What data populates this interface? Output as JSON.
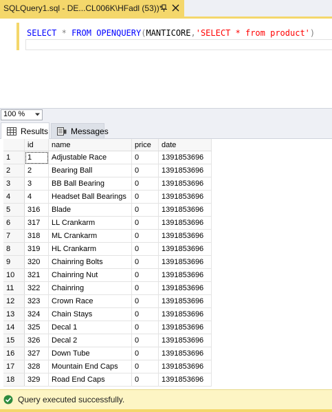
{
  "tab": {
    "title": "SQLQuery1.sql - DE...CL006K\\HFadl (53))*"
  },
  "editor": {
    "kw_select": "SELECT",
    "star": "*",
    "kw_from": "FROM",
    "kw_openquery": "OPENQUERY",
    "open_paren": "(",
    "server": "MANTICORE",
    "comma": ",",
    "query_string": "'SELECT * from product'",
    "close_paren": ")"
  },
  "zoom": {
    "value": "100 %"
  },
  "result_tabs": {
    "results": "Results",
    "messages": "Messages"
  },
  "grid": {
    "columns": [
      "id",
      "name",
      "price",
      "date"
    ],
    "rows": [
      {
        "n": "1",
        "id": "1",
        "name": "Adjustable Race",
        "price": "0",
        "date": "1391853696"
      },
      {
        "n": "2",
        "id": "2",
        "name": "Bearing Ball",
        "price": "0",
        "date": "1391853696"
      },
      {
        "n": "3",
        "id": "3",
        "name": "BB Ball Bearing",
        "price": "0",
        "date": "1391853696"
      },
      {
        "n": "4",
        "id": "4",
        "name": "Headset Ball Bearings",
        "price": "0",
        "date": "1391853696"
      },
      {
        "n": "5",
        "id": "316",
        "name": "Blade",
        "price": "0",
        "date": "1391853696"
      },
      {
        "n": "6",
        "id": "317",
        "name": "LL Crankarm",
        "price": "0",
        "date": "1391853696"
      },
      {
        "n": "7",
        "id": "318",
        "name": "ML Crankarm",
        "price": "0",
        "date": "1391853696"
      },
      {
        "n": "8",
        "id": "319",
        "name": "HL Crankarm",
        "price": "0",
        "date": "1391853696"
      },
      {
        "n": "9",
        "id": "320",
        "name": "Chainring Bolts",
        "price": "0",
        "date": "1391853696"
      },
      {
        "n": "10",
        "id": "321",
        "name": "Chainring Nut",
        "price": "0",
        "date": "1391853696"
      },
      {
        "n": "11",
        "id": "322",
        "name": "Chainring",
        "price": "0",
        "date": "1391853696"
      },
      {
        "n": "12",
        "id": "323",
        "name": "Crown Race",
        "price": "0",
        "date": "1391853696"
      },
      {
        "n": "13",
        "id": "324",
        "name": "Chain Stays",
        "price": "0",
        "date": "1391853696"
      },
      {
        "n": "14",
        "id": "325",
        "name": "Decal 1",
        "price": "0",
        "date": "1391853696"
      },
      {
        "n": "15",
        "id": "326",
        "name": "Decal 2",
        "price": "0",
        "date": "1391853696"
      },
      {
        "n": "16",
        "id": "327",
        "name": "Down Tube",
        "price": "0",
        "date": "1391853696"
      },
      {
        "n": "17",
        "id": "328",
        "name": "Mountain End Caps",
        "price": "0",
        "date": "1391853696"
      },
      {
        "n": "18",
        "id": "329",
        "name": "Road End Caps",
        "price": "0",
        "date": "1391853696"
      }
    ]
  },
  "status": {
    "message": "Query executed successfully."
  },
  "colors": {
    "accent": "#f4d76b",
    "keyword": "#0000ff",
    "string": "#ff0000",
    "operator": "#808080",
    "status_bg": "#fdf5c4",
    "success_green": "#2e8b3e"
  },
  "icons": {
    "pin": "pin-icon",
    "close": "close-icon",
    "zoom_dropdown": "chevron-down-icon",
    "results": "grid-icon",
    "messages": "messages-icon",
    "status": "checkmark-circle-icon"
  }
}
